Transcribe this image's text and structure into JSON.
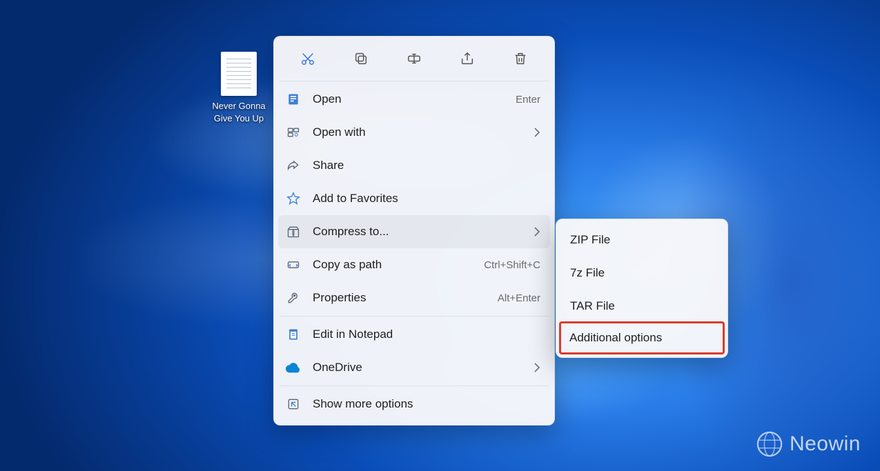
{
  "desktop": {
    "file_label": "Never Gonna Give You Up"
  },
  "context_menu": {
    "toolbar_icons": [
      "cut",
      "copy",
      "rename",
      "share",
      "delete"
    ],
    "items": [
      {
        "icon": "open",
        "label": "Open",
        "shortcut": "Enter"
      },
      {
        "icon": "open-with",
        "label": "Open with",
        "submenu": true
      },
      {
        "icon": "share",
        "label": "Share"
      },
      {
        "icon": "star",
        "label": "Add to Favorites"
      },
      {
        "icon": "compress",
        "label": "Compress to...",
        "submenu": true,
        "highlighted": true
      },
      {
        "icon": "copy-path",
        "label": "Copy as path",
        "shortcut": "Ctrl+Shift+C"
      },
      {
        "icon": "properties",
        "label": "Properties",
        "shortcut": "Alt+Enter"
      }
    ],
    "group2": [
      {
        "icon": "notepad",
        "label": "Edit in Notepad"
      },
      {
        "icon": "onedrive",
        "label": "OneDrive",
        "submenu": true
      }
    ],
    "group3": [
      {
        "icon": "more",
        "label": "Show more options"
      }
    ]
  },
  "submenu": {
    "items": [
      {
        "label": "ZIP File"
      },
      {
        "label": "7z File"
      },
      {
        "label": "TAR File"
      },
      {
        "label": "Additional options",
        "highlighted": true
      }
    ]
  },
  "watermark": {
    "text": "Neowin"
  }
}
